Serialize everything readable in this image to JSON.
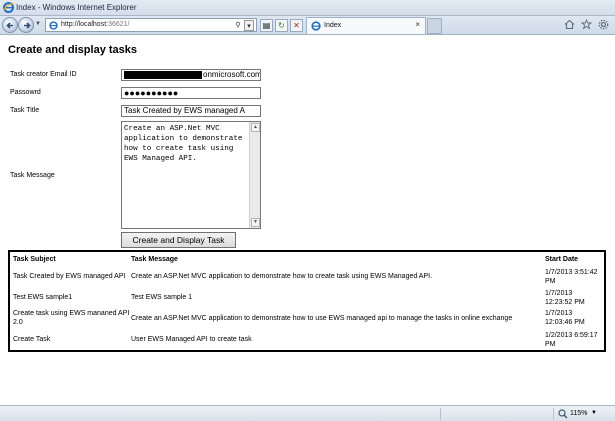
{
  "window": {
    "title": "Index - Windows Internet Explorer"
  },
  "nav": {
    "url_host": "http://localhost:",
    "url_port": "36621/",
    "tab_label": "Index",
    "tab_close": "×"
  },
  "page": {
    "heading": "Create and display tasks",
    "labels": {
      "email": "Task creator Email ID",
      "password": "Passowrd",
      "title": "Task Title",
      "message": "Task Message"
    },
    "email_value_visible": "onmicrosoft.com",
    "password_mask": "●●●●●●●●●●",
    "task_title_value": "Task Created by EWS managed A",
    "task_message_value": "Create an ASP.Net MVC application to demonstrate how to create task using EWS Managed API.",
    "submit_label": "Create and Display Task"
  },
  "table": {
    "headers": [
      "Task Subject",
      "Task Message",
      "Start Date"
    ],
    "rows": [
      {
        "subject": "Task Created by EWS managed API",
        "message": "Create an ASP.Net MVC application to demonstrate how to create task using EWS Managed API.",
        "date": "1/7/2013 3:51:42 PM"
      },
      {
        "subject": "Test EWS sample1",
        "message": "Test EWS sample 1",
        "date": "1/7/2013 12:23:52 PM"
      },
      {
        "subject": "Create task using EWS mananed API 2.0",
        "message": "Create an ASP.Net MVC application to demonstrate how to use EWS managed api to manage the tasks in online exchange",
        "date": "1/7/2013 12:03:46 PM"
      },
      {
        "subject": "Create Task",
        "message": "User EWS Managed API to create task",
        "date": "1/2/2013 6:59:17 PM"
      }
    ]
  },
  "status": {
    "zoom": "115%",
    "zoom_drop": "▼"
  },
  "icons": [
    "ie-icon",
    "back-icon",
    "forward-icon",
    "refresh-icon",
    "stop-icon",
    "search-icon",
    "home-icon",
    "favorites-icon",
    "tools-icon",
    "zoom-icon"
  ]
}
